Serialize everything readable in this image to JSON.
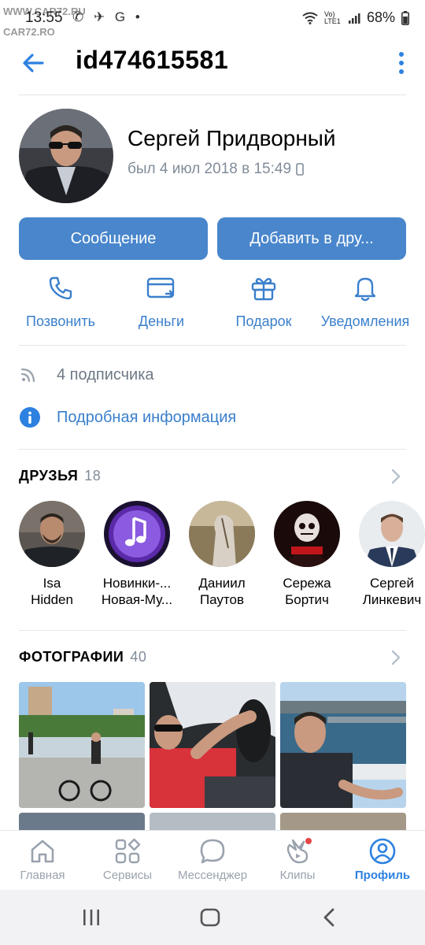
{
  "status_bar": {
    "time": "13:55",
    "left_icons": "✆ ✈ G •",
    "watermark_top": "WWW.CAR72.RU",
    "watermark_bottom": "CAR72.RO",
    "signal_text": "Vo) LTE1",
    "battery": "68%"
  },
  "header": {
    "title": "id474615581"
  },
  "profile": {
    "name": "Сергей Придворный",
    "last_seen": "был 4 июл 2018 в 15:49"
  },
  "buttons": {
    "message": "Сообщение",
    "add_friend": "Добавить в дру..."
  },
  "actions": [
    {
      "label": "Позвонить",
      "icon": "phone-icon"
    },
    {
      "label": "Деньги",
      "icon": "money-icon"
    },
    {
      "label": "Подарок",
      "icon": "gift-icon"
    },
    {
      "label": "Уведомления",
      "icon": "bell-icon"
    }
  ],
  "info": {
    "followers": "4 подписчика",
    "details": "Подробная информация"
  },
  "friends_section": {
    "title": "ДРУЗЬЯ",
    "count": "18",
    "items": [
      {
        "line1": "Isa",
        "line2": "Hidden"
      },
      {
        "line1": "Новинки-...",
        "line2": "Новая-Му..."
      },
      {
        "line1": "Даниил",
        "line2": "Паутов"
      },
      {
        "line1": "Сережа",
        "line2": "Бортич"
      },
      {
        "line1": "Сергей",
        "line2": "Линкевич"
      }
    ]
  },
  "photos_section": {
    "title": "ФОТОГРАФИИ",
    "count": "40"
  },
  "bottom_nav": [
    {
      "label": "Главная",
      "icon": "home-icon"
    },
    {
      "label": "Сервисы",
      "icon": "services-icon"
    },
    {
      "label": "Мессенджер",
      "icon": "messenger-icon"
    },
    {
      "label": "Клипы",
      "icon": "clips-icon"
    },
    {
      "label": "Профиль",
      "icon": "profile-icon",
      "active": true
    }
  ],
  "colors": {
    "accent": "#4986cc",
    "link": "#3a7fcc",
    "secondary_text": "#818c99",
    "nav_active": "#2d81e0"
  }
}
